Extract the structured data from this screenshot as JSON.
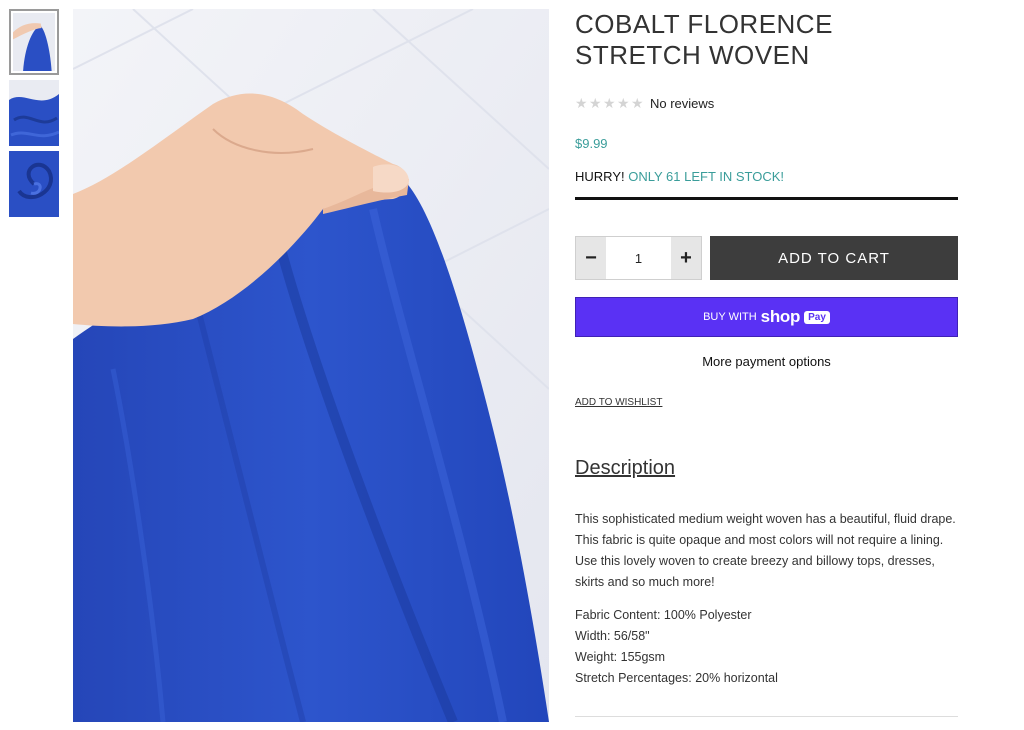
{
  "product": {
    "title_line1": "COBALT FLORENCE",
    "title_line2": "STRETCH WOVEN",
    "reviews_text": "No reviews",
    "rating": 0,
    "price": "$9.99",
    "stock_prefix": "HURRY! ",
    "stock_highlight": "ONLY 61 LEFT IN STOCK!"
  },
  "gallery": {
    "thumbnails": [
      "hand-holding-fabric",
      "folded-fabric",
      "swirled-fabric"
    ],
    "selected": 0
  },
  "purchase": {
    "minus_symbol": "−",
    "plus_symbol": "+",
    "quantity": "1",
    "add_to_cart": "ADD TO CART",
    "shop_pay_prefix": "BUY WITH",
    "shop_pay_brand": "shop",
    "shop_pay_badge": "Pay",
    "more_payment": "More payment options",
    "wishlist": "ADD TO WISHLIST"
  },
  "description": {
    "heading": "Description",
    "body": "This sophisticated medium weight woven has a beautiful, fluid drape. This fabric is quite opaque and most colors will not require a lining. Use this lovely woven to create breezy and billowy tops, dresses, skirts and so much more!",
    "specs": [
      "Fabric Content: 100% Polyester",
      "Width: 56/58\"",
      "Weight: 155gsm",
      "Stretch Percentages: 20% horizontal"
    ]
  },
  "colors": {
    "accent": "#3a9d9a",
    "fabric": "#2a4fc4",
    "cart_button": "#3d3d3d",
    "shop_pay": "#5a31f4"
  }
}
